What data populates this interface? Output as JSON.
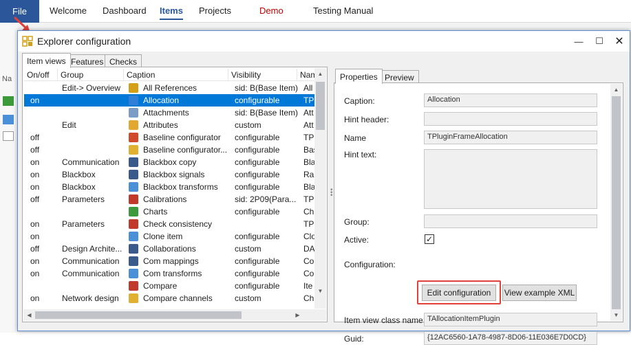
{
  "app": {
    "file_label": "File",
    "menu": [
      "Welcome",
      "Dashboard",
      "Items",
      "Projects",
      "Demo",
      "Testing Manual"
    ],
    "left_fragment": "Na"
  },
  "dialog": {
    "title": "Explorer configuration",
    "controls": {
      "minimize": "—",
      "maximize": "☐",
      "close": "✕"
    },
    "left_tabs": [
      "Item views",
      "Features",
      "Checks"
    ],
    "right_tabs": [
      "Properties",
      "Preview"
    ]
  },
  "grid": {
    "columns": [
      "On/off",
      "Group",
      "Caption",
      "Visibility",
      "Name"
    ],
    "rows": [
      {
        "onoff": "",
        "group": "Edit-> Overview",
        "caption": "All References",
        "visibility": "sid: B(Base Item)",
        "name": "All",
        "icon": "references-icon",
        "color": "#d4a017"
      },
      {
        "onoff": "on",
        "group": "",
        "caption": "Allocation",
        "visibility": "configurable",
        "name": "TPl",
        "icon": "allocation-icon",
        "color": "#2f7fd8",
        "selected": true
      },
      {
        "onoff": "",
        "group": "",
        "caption": "Attachments",
        "visibility": "sid: B(Base Item)",
        "name": "Att",
        "icon": "attachment-icon",
        "color": "#7a9cc6"
      },
      {
        "onoff": "",
        "group": "Edit",
        "caption": "Attributes",
        "visibility": "custom",
        "name": "Att",
        "icon": "attributes-icon",
        "color": "#e2a72e"
      },
      {
        "onoff": "off",
        "group": "",
        "caption": "Baseline configurator",
        "visibility": "configurable",
        "name": "TPl",
        "icon": "baseline-icon",
        "color": "#d14a2b"
      },
      {
        "onoff": "off",
        "group": "",
        "caption": "Baseline configurator...",
        "visibility": "configurable",
        "name": "Bas",
        "icon": "baseline-icon",
        "color": "#e0b030"
      },
      {
        "onoff": "on",
        "group": "Communication",
        "caption": "Blackbox copy",
        "visibility": "configurable",
        "name": "Bla",
        "icon": "blackbox-copy-icon",
        "color": "#3a5a8c"
      },
      {
        "onoff": "on",
        "group": "Blackbox",
        "caption": "Blackbox signals",
        "visibility": "configurable",
        "name": "Ra",
        "icon": "signals-icon",
        "color": "#3a5a8c"
      },
      {
        "onoff": "on",
        "group": "Blackbox",
        "caption": "Blackbox transforms",
        "visibility": "configurable",
        "name": "Bla",
        "icon": "transforms-icon",
        "color": "#4a90d9"
      },
      {
        "onoff": "off",
        "group": "Parameters",
        "caption": "Calibrations",
        "visibility": "sid: 2P09(Para...",
        "name": "TPl",
        "icon": "calibrations-icon",
        "color": "#c0392b"
      },
      {
        "onoff": "",
        "group": "",
        "caption": "Charts",
        "visibility": "configurable",
        "name": "Ch",
        "icon": "chart-icon",
        "color": "#3c9a3c"
      },
      {
        "onoff": "on",
        "group": "Parameters",
        "caption": "Check consistency",
        "visibility": "",
        "name": "TPl",
        "icon": "check-icon",
        "color": "#c0392b"
      },
      {
        "onoff": "on",
        "group": "",
        "caption": "Clone item",
        "visibility": "configurable",
        "name": "Clo",
        "icon": "clone-icon",
        "color": "#4a90d9"
      },
      {
        "onoff": "off",
        "group": "Design Archite...",
        "caption": "Collaborations",
        "visibility": "custom",
        "name": "DA",
        "icon": "collaborations-icon",
        "color": "#3a5a8c"
      },
      {
        "onoff": "on",
        "group": "Communication",
        "caption": "Com mappings",
        "visibility": "configurable",
        "name": "Co",
        "icon": "mappings-icon",
        "color": "#3a5a8c"
      },
      {
        "onoff": "on",
        "group": "Communication",
        "caption": "Com transforms",
        "visibility": "configurable",
        "name": "Co",
        "icon": "com-transforms-icon",
        "color": "#4a90d9"
      },
      {
        "onoff": "",
        "group": "",
        "caption": "Compare",
        "visibility": "configurable",
        "name": "Ite",
        "icon": "compare-icon",
        "color": "#c0392b"
      },
      {
        "onoff": "on",
        "group": "Network design",
        "caption": "Compare channels",
        "visibility": "custom",
        "name": "Ch",
        "icon": "compare-channels-icon",
        "color": "#e0b030"
      }
    ]
  },
  "properties": {
    "labels": {
      "caption": "Caption:",
      "hint_header": "Hint header:",
      "name": "Name",
      "hint_text": "Hint text:",
      "group": "Group:",
      "active": "Active:",
      "configuration": "Configuration:",
      "class_name": "Item view class name:",
      "guid": "Guid:"
    },
    "values": {
      "caption": "Allocation",
      "hint_header": "",
      "name": "TPluginFrameAllocation",
      "hint_text": "",
      "group": "",
      "active_mark": "✓",
      "class_name": "TAllocationItemPlugin",
      "guid": "{12AC6560-1A78-4987-8D06-11E036E7D0CD}"
    },
    "buttons": {
      "edit_configuration": "Edit configuration",
      "view_example": "View example XML"
    }
  },
  "colors": {
    "selection": "#0078d7",
    "file_tab": "#2b579a",
    "highlight_box": "#e0413b",
    "arrow": "#e0413b"
  }
}
